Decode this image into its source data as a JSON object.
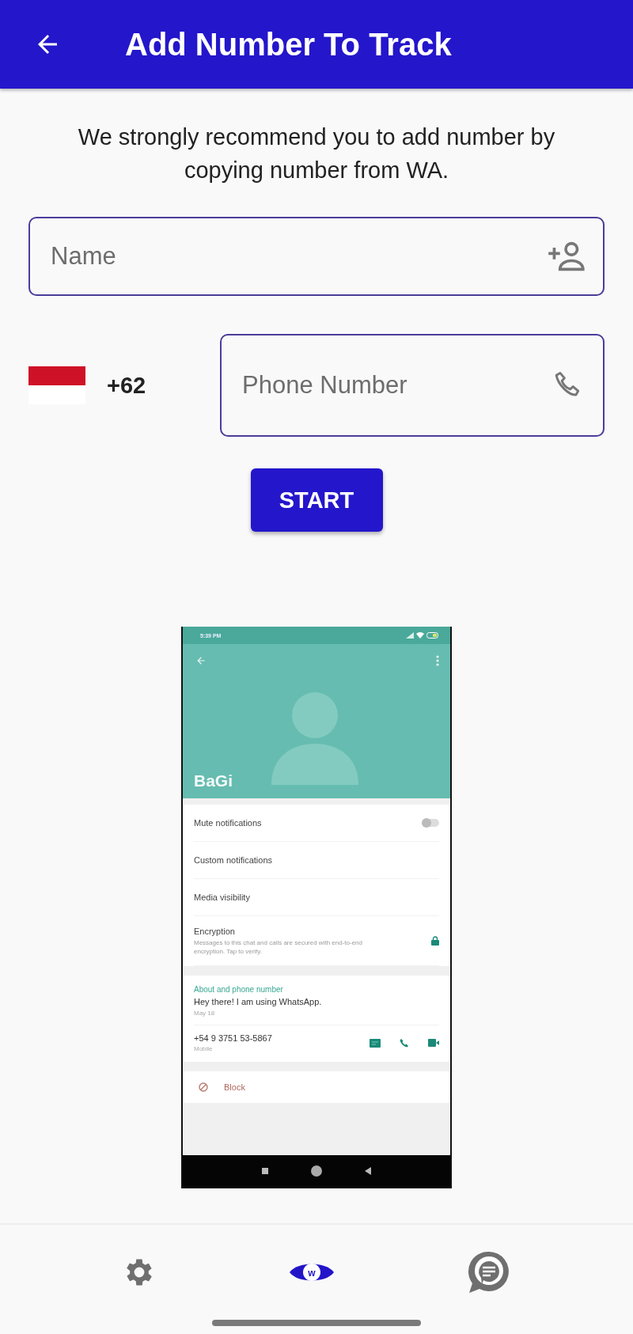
{
  "app_bar": {
    "title": "Add Number To Track"
  },
  "intro": "We strongly recommend you to add number by copying number from WA.",
  "name_field": {
    "placeholder": "Name"
  },
  "country_code": "+62",
  "phone_field": {
    "placeholder": "Phone Number"
  },
  "start_button": "START",
  "guide_screenshot": {
    "status_time": "5:39 PM",
    "contact_name": "BaGi",
    "settings": [
      {
        "kind": "toggle",
        "label": "Mute notifications",
        "on": false
      },
      {
        "kind": "plain",
        "label": "Custom notifications"
      },
      {
        "kind": "plain",
        "label": "Media visibility"
      },
      {
        "kind": "lock",
        "label": "Encryption",
        "detail": "Messages to this chat and calls are secured with end-to-end encryption. Tap to verify."
      }
    ],
    "about_heading": "About and phone number",
    "about_text": "Hey there! I am using WhatsApp.",
    "about_date": "May 18",
    "phone": "+54 9 3751 53-5867",
    "phone_type": "Mobile",
    "block_label": "Block"
  },
  "bottom_nav": [
    {
      "kind": "settings",
      "selected": false
    },
    {
      "kind": "eye",
      "mark": "w",
      "selected": true
    },
    {
      "kind": "chat",
      "selected": false
    }
  ]
}
